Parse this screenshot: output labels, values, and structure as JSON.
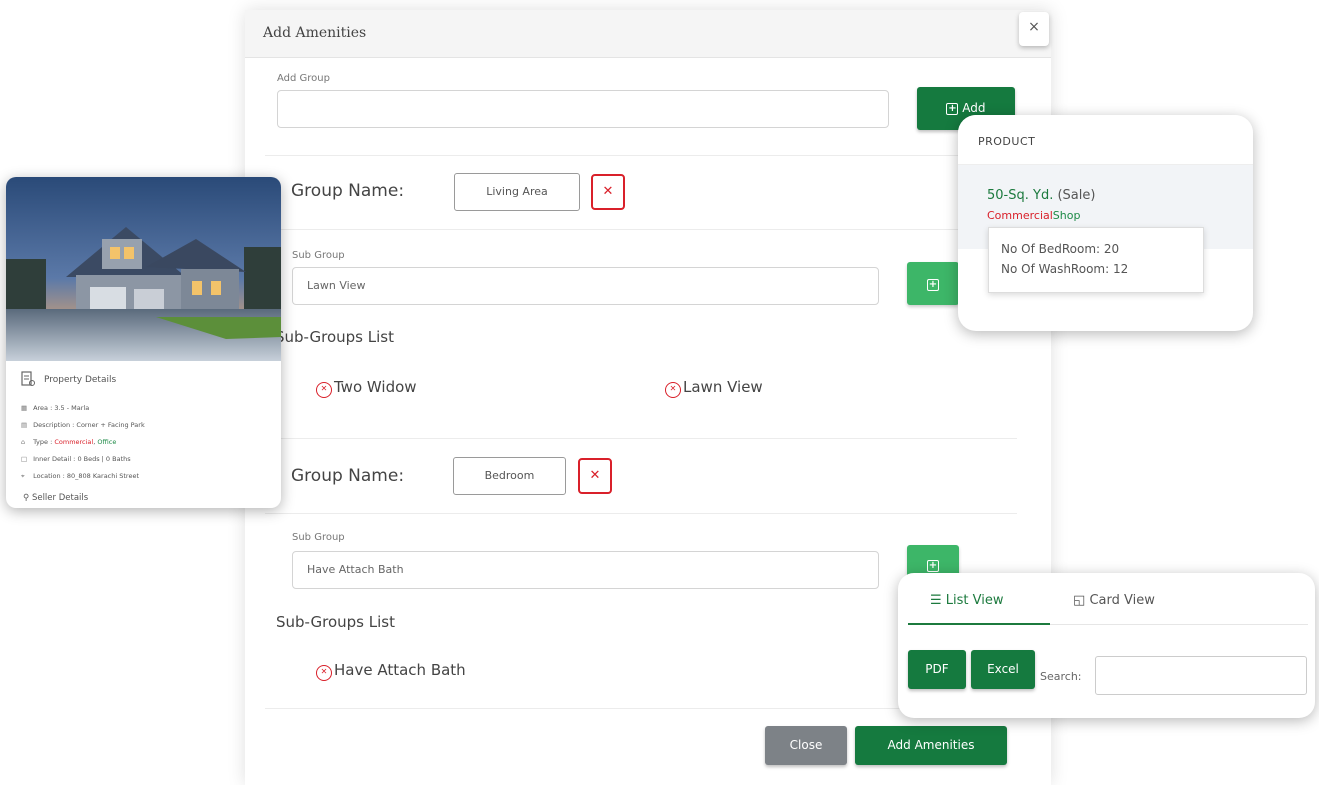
{
  "modal": {
    "title": "Add Amenities",
    "close_glyph": "×",
    "add_group_label": "Add Group",
    "add_group_value": "",
    "add_button": "Add",
    "groups": [
      {
        "label": "Group Name:",
        "name": "Living Area",
        "sub_group_label": "Sub Group",
        "sub_group_value": "Lawn View",
        "list_title": "Sub-Groups List",
        "items": [
          "Two Widow",
          "Lawn View"
        ]
      },
      {
        "label": "Group Name:",
        "name": "Bedroom",
        "sub_group_label": "Sub Group",
        "sub_group_value": "Have Attach Bath",
        "list_title": "Sub-Groups List",
        "items": [
          "Have Attach Bath"
        ]
      }
    ],
    "close_button": "Close",
    "submit_button": "Add Amenities"
  },
  "property_card": {
    "title": "Property Details",
    "rows": [
      {
        "icon": "area-icon",
        "text": "Area : 3.5 - Marla"
      },
      {
        "icon": "description-icon",
        "text": "Description : Corner + Facing Park"
      },
      {
        "icon": "type-icon",
        "prefix": "Type : ",
        "type_main": "Commercial",
        "type_sub": "Office"
      },
      {
        "icon": "inner-detail-icon",
        "text": "Inner Detail : 0 Beds | 0 Baths"
      },
      {
        "icon": "location-icon",
        "text": "Location : 80_808 Karachi Street"
      }
    ],
    "seller_label": "Seller Details"
  },
  "product_card": {
    "header": "PRODUCT",
    "size": "50-Sq. Yd.",
    "status": "(Sale)",
    "type_main": "Commercial",
    "type_sub": "Shop",
    "bedrooms": "No Of BedRoom: 20",
    "washrooms": "No Of WashRoom: 12"
  },
  "list_card": {
    "tabs": [
      "List View",
      "Card View"
    ],
    "active_tab": "List View",
    "pdf_button": "PDF",
    "excel_button": "Excel",
    "search_label": "Search:",
    "search_value": ""
  },
  "colors": {
    "primary_green": "#157a3f",
    "light_green": "#3db668",
    "danger_red": "#d9202a",
    "close_gray": "#7d8287"
  }
}
